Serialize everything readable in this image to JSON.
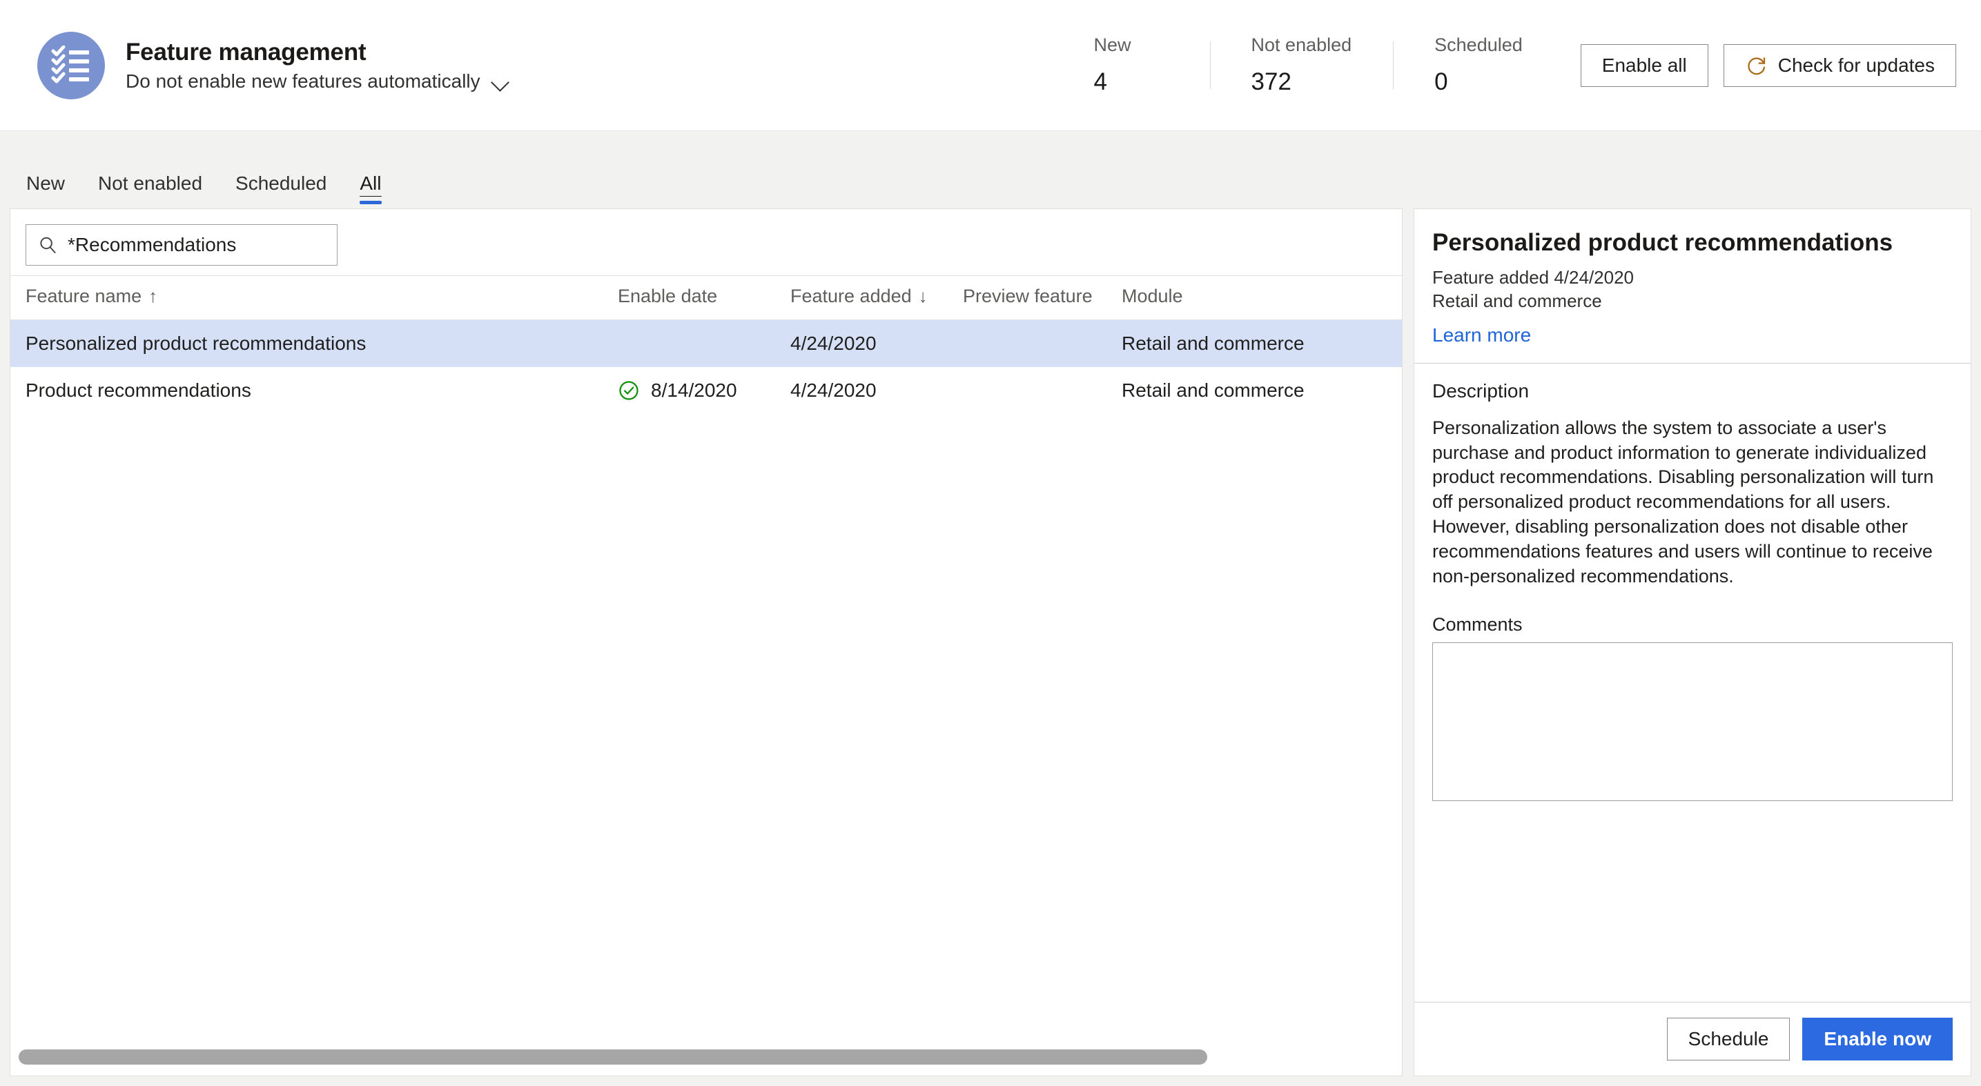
{
  "header": {
    "icon": "checklist-icon",
    "title": "Feature management",
    "subtitle": "Do not enable new features automatically",
    "chevron_icon": "chevron-down-icon",
    "stats": [
      {
        "label": "New",
        "value": "4"
      },
      {
        "label": "Not enabled",
        "value": "372"
      },
      {
        "label": "Scheduled",
        "value": "0"
      }
    ],
    "actions": {
      "enable_all": "Enable all",
      "check_updates": "Check for updates",
      "check_updates_icon": "refresh-icon"
    }
  },
  "tabs": [
    {
      "label": "New",
      "active": false
    },
    {
      "label": "Not enabled",
      "active": false
    },
    {
      "label": "Scheduled",
      "active": false
    },
    {
      "label": "All",
      "active": true
    }
  ],
  "search": {
    "icon": "search-icon",
    "value": "*Recommendations",
    "placeholder": "Filter"
  },
  "grid": {
    "columns": [
      {
        "label": "Feature name",
        "sort": "↑"
      },
      {
        "label": "Enable date",
        "sort": ""
      },
      {
        "label": "Feature added",
        "sort": "↓"
      },
      {
        "label": "Preview feature",
        "sort": ""
      },
      {
        "label": "Module",
        "sort": ""
      }
    ],
    "rows": [
      {
        "feature_name": "Personalized product recommendations",
        "enabled_icon": "",
        "enable_date": "",
        "feature_added": "4/24/2020",
        "preview_feature": "",
        "module": "Retail and commerce",
        "selected": true
      },
      {
        "feature_name": "Product recommendations",
        "enabled_icon": "green-check-circle-icon",
        "enable_date": "8/14/2020",
        "feature_added": "4/24/2020",
        "preview_feature": "",
        "module": "Retail and commerce",
        "selected": false
      }
    ],
    "scrollbar": "horizontal-scrollbar"
  },
  "detail": {
    "title": "Personalized product recommendations",
    "added": "Feature added 4/24/2020",
    "module": "Retail and commerce",
    "learn_more": "Learn more",
    "description_label": "Description",
    "description": "Personalization allows the system to associate a user's purchase and product information to generate individualized product recommendations. Disabling personalization will turn off personalized product recommendations for all users. However, disabling personalization does not disable other recommendations features and users will continue to receive non-personalized recommendations.",
    "comments_label": "Comments",
    "comments_value": "",
    "schedule_label": "Schedule",
    "enable_now_label": "Enable now"
  },
  "colors": {
    "accent": "#2b6ae0",
    "tab_underline": "#2d68d8",
    "link": "#1f64d8",
    "brand_circle": "#7a92cf",
    "row_selected": "#d5e0f7",
    "success": "#13a10e"
  }
}
